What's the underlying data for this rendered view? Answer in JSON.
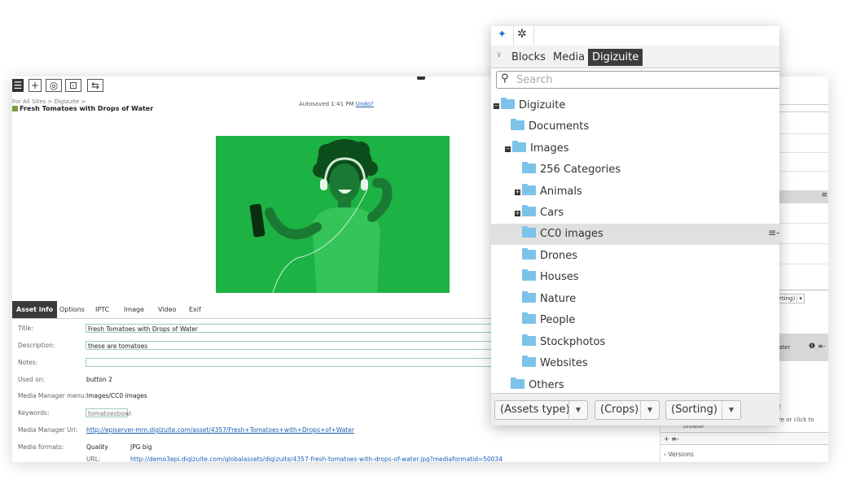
{
  "editor": {
    "toolbar": {
      "add_label": "+",
      "preview_label": "◎",
      "compare_label": "⊡",
      "toggle_label": "⇆"
    },
    "breadcrumb": "For All Sites > Digizuite >",
    "title": "Fresh Tomatoes with Drops of Water",
    "autosave": "Autosaved 1:41 PM",
    "undo": "Undo?",
    "asset_tabs": [
      "Asset info",
      "Options",
      "IPTC",
      "Image",
      "Video",
      "Exif"
    ],
    "fields": {
      "title_label": "Title:",
      "title_value": "Fresh Tomatoes with Drops of Water",
      "description_label": "Description:",
      "description_value": "these are tomatoes",
      "notes_label": "Notes:",
      "notes_value": "",
      "used_on_label": "Used on:",
      "used_on_value": "button 2",
      "menu_label": "Media Manager menu:",
      "menu_value": "Images/CC0 images",
      "keywords_label": "Keywords:",
      "keywords_value": "tomatoesbowl",
      "url_label": "Media Manager Url:",
      "url_value": "http://episerver-mm.digizuite.com/asset/4357/Fresh+Tomatoes+with+Drops+of+Water",
      "formats_label": "Media formats:",
      "quality_label": "Quality",
      "quality_value": "JPG big",
      "format_url_label": "URL:",
      "format_url_value": "http://demo3epi.digizuite.com/globalassets/digizuite/4357-fresh-tomatoes-with-drops-of-water.jpg?mediaformatid=50034"
    }
  },
  "right_panel": {
    "sorting_fragment": "rting)",
    "item_fragment": "ater",
    "drop_fragment": "t",
    "drop_hint": "re or click to",
    "browse": "browse",
    "add": "+ ≡-",
    "versions": "Versions"
  },
  "popup": {
    "pin_icon": "pin-icon",
    "settings_icon": "gear-icon",
    "tabs": [
      "Blocks",
      "Media",
      "Digizuite"
    ],
    "active_tab": "Digizuite",
    "search_placeholder": "Search",
    "tree": {
      "root": "Digizuite",
      "documents": "Documents",
      "images": "Images",
      "cat256": "256 Categories",
      "animals": "Animals",
      "cars": "Cars",
      "cc0": "CC0 images",
      "drones": "Drones",
      "houses": "Houses",
      "nature": "Nature",
      "people": "People",
      "stockphotos": "Stockphotos",
      "websites": "Websites",
      "others": "Others"
    },
    "filters": [
      "(Assets type)",
      "(Crops)",
      "(Sorting)"
    ]
  },
  "colors": {
    "photo_bg": "#1db244",
    "folder": "#7cc3ea",
    "link": "#1a5fb4"
  }
}
